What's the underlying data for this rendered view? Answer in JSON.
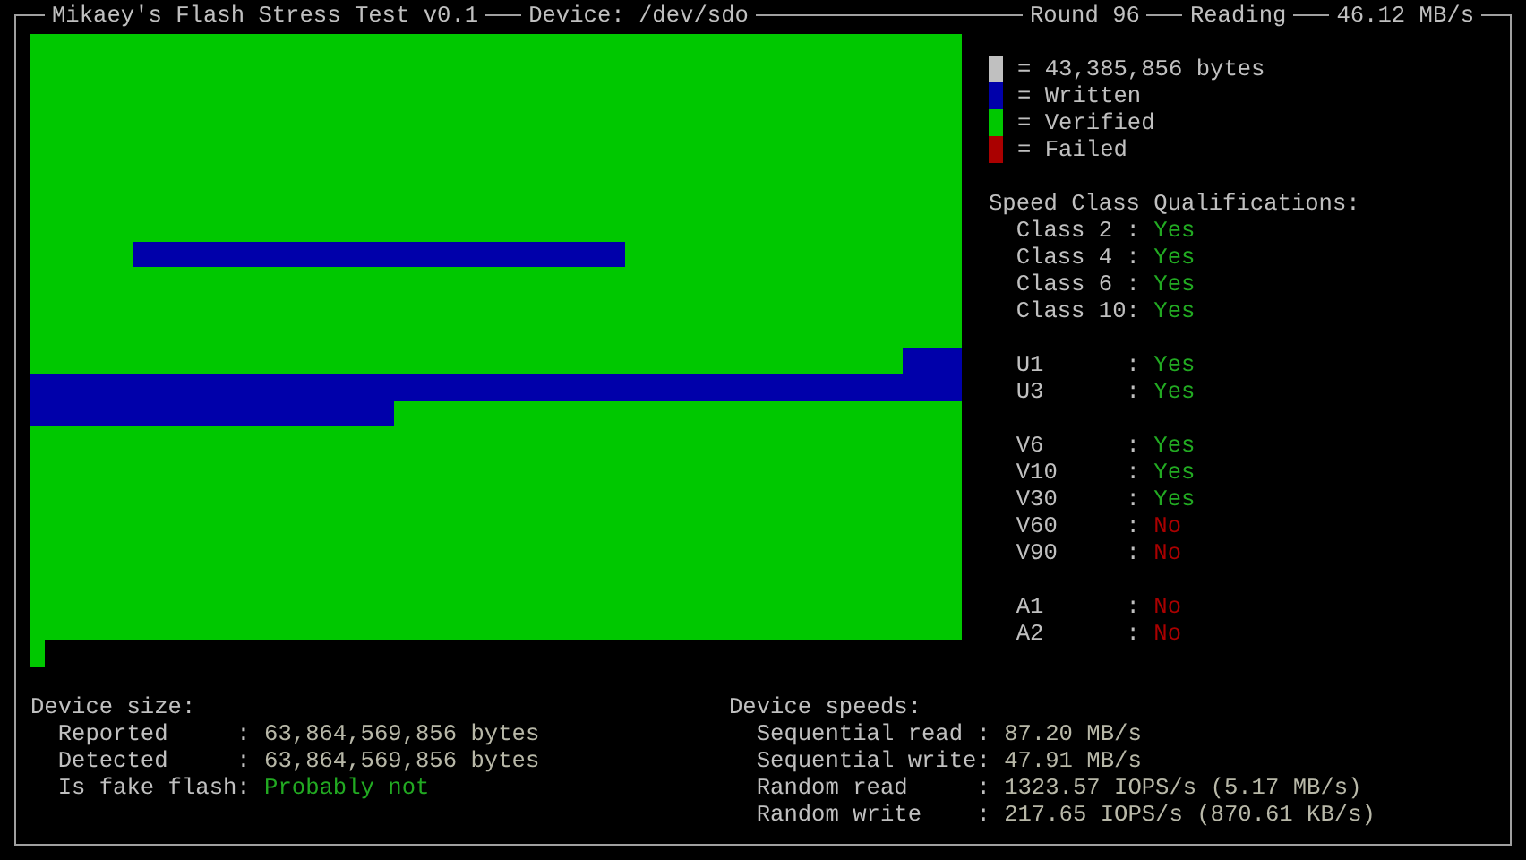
{
  "header": {
    "title": "Mikaey's Flash Stress Test v0.1",
    "device": "Device: /dev/sdo",
    "round": "Round 96",
    "mode": "Reading",
    "speed": "46.12 MB/s"
  },
  "legend": [
    {
      "color": "#c0c0c0",
      "label": "= 43,385,856 bytes"
    },
    {
      "color": "#0000aa",
      "label": "= Written"
    },
    {
      "color": "#00c800",
      "label": "= Verified"
    },
    {
      "color": "#aa0000",
      "label": "= Failed"
    }
  ],
  "qualifications": {
    "title": "Speed Class Qualifications:",
    "groups": [
      [
        {
          "label": "Class 2 :",
          "value": "Yes",
          "passed": true
        },
        {
          "label": "Class 4 :",
          "value": "Yes",
          "passed": true
        },
        {
          "label": "Class 6 :",
          "value": "Yes",
          "passed": true
        },
        {
          "label": "Class 10:",
          "value": "Yes",
          "passed": true
        }
      ],
      [
        {
          "label": "U1      :",
          "value": "Yes",
          "passed": true
        },
        {
          "label": "U3      :",
          "value": "Yes",
          "passed": true
        }
      ],
      [
        {
          "label": "V6      :",
          "value": "Yes",
          "passed": true
        },
        {
          "label": "V10     :",
          "value": "Yes",
          "passed": true
        },
        {
          "label": "V30     :",
          "value": "Yes",
          "passed": true
        },
        {
          "label": "V60     :",
          "value": "No",
          "passed": false
        },
        {
          "label": "V90     :",
          "value": "No",
          "passed": false
        }
      ],
      [
        {
          "label": "A1      :",
          "value": "No",
          "passed": false
        },
        {
          "label": "A2      :",
          "value": "No",
          "passed": false
        }
      ]
    ]
  },
  "device_size": {
    "title": "Device size:",
    "rows": [
      {
        "label": "Reported     :",
        "value": "63,864,569,856 bytes",
        "kind": "plain"
      },
      {
        "label": "Detected     :",
        "value": "63,864,569,856 bytes",
        "kind": "plain"
      },
      {
        "label": "Is fake flash:",
        "value": "Probably not",
        "kind": "good"
      }
    ]
  },
  "device_speeds": {
    "title": "Device speeds:",
    "rows": [
      {
        "label": "Sequential read :",
        "value": "87.20 MB/s",
        "kind": "plain"
      },
      {
        "label": "Sequential write:",
        "value": "47.91 MB/s",
        "kind": "plain"
      },
      {
        "label": "Random read     :",
        "value": "1323.57 IOPS/s (5.17 MB/s)",
        "kind": "plain"
      },
      {
        "label": "Random write    :",
        "value": "217.65 IOPS/s (870.61 KB/s)",
        "kind": "plain"
      }
    ]
  }
}
